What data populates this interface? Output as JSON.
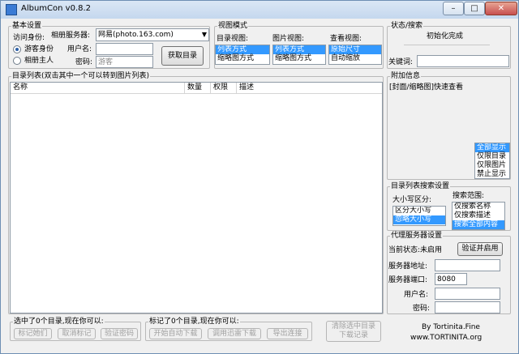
{
  "window": {
    "title": "AlbumCon v0.8.2",
    "minimize": "–",
    "maximize": "□",
    "close": "✕"
  },
  "basic": {
    "title": "基本设置",
    "identity_label": "访问身份:",
    "guest_radio": "游客身份",
    "owner_radio": "相册主人",
    "server_label": "相册服务器:",
    "server_value": "网易(photo.163.com)",
    "username_label": "用户名:",
    "username_value": "",
    "password_label": "密码:",
    "password_placeholder": "游客",
    "fetch_button": "获取目录"
  },
  "view_mode": {
    "title": "视图模式",
    "dir_view": {
      "label": "目录视图:",
      "items": [
        "列表方式",
        "缩略图方式"
      ],
      "selected": 0
    },
    "pic_view": {
      "label": "图片视图:",
      "items": [
        "列表方式",
        "缩略图方式"
      ],
      "selected": 0
    },
    "look_view": {
      "label": "查看视图:",
      "items": [
        "原始尺寸",
        "自动缩放"
      ],
      "selected": 0
    }
  },
  "status": {
    "title": "状态/搜索",
    "status_text": "初始化完成",
    "keyword_label": "关键词:",
    "keyword_value": ""
  },
  "dir_list": {
    "title": "目录列表(双击其中一个可以转到图片列表)",
    "columns": [
      "名称",
      "数量",
      "权限",
      "描述"
    ]
  },
  "extra": {
    "title": "附加信息",
    "quick_view": "[封面/缩略图]快速查看",
    "options": [
      "全部显示",
      "仅限目录",
      "仅限图片",
      "禁止显示"
    ],
    "selected": 0
  },
  "search_settings": {
    "title": "目录列表搜索设置",
    "case_label": "大小写区分:",
    "case_options": [
      "区分大小写",
      "忽略大小写"
    ],
    "case_selected": 1,
    "scope_label": "搜索范围:",
    "scope_options": [
      "仅搜索名称",
      "仅搜索描述",
      "搜索全部内容"
    ],
    "scope_selected": 2
  },
  "proxy": {
    "title": "代理服务器设置",
    "state_label": "当前状态:未启用",
    "verify_button": "验证并启用",
    "address_label": "服务器地址:",
    "address_value": "",
    "port_label": "服务器端口:",
    "port_value": "8080",
    "user_label": "用户名:",
    "user_value": "",
    "pass_label": "密码:",
    "pass_value": ""
  },
  "selected_group": {
    "title": "选中了0个目录,现在你可以:",
    "buttons": [
      "标记她们",
      "取消标记",
      "验证密码"
    ]
  },
  "marked_group": {
    "title": "标记了0个目录,现在你可以:",
    "buttons": [
      "开始自动下载",
      "调用迅雷下载",
      "导出连接"
    ]
  },
  "clear_button": {
    "line1": "清除选中目录",
    "line2": "下载记录"
  },
  "credits": {
    "line1": "By Tortinita.Fine",
    "line2": "www.TORTINITA.org"
  }
}
